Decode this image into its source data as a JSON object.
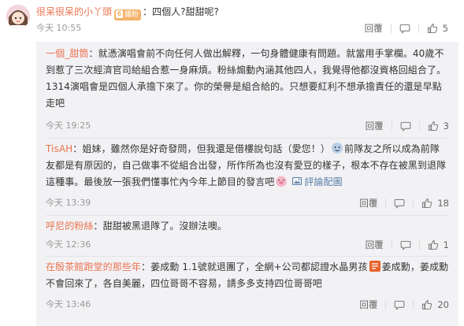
{
  "main_comment": {
    "username": "很呆很呆的小丫頭",
    "badge_level": "6",
    "badge_label": "鐵粉",
    "text": "：四個人?甜甜呢?",
    "time": "今天 10:55",
    "reply_label": "回覆",
    "like_count": "5"
  },
  "replies": [
    {
      "username": "一個_甜筒",
      "text": "：就憑演唱會前不向任何人做出解釋，一句身體健康有問題。就當用手掌欄。40歲不到惹了三次經濟官司給組合惹一身麻煩。粉絲煽動內涵其他四人，我覺得他都沒資格回組合了。1314演唱會是四個人承擔下來了。你的榮譽是組合給的。只想要紅利不想承擔責任的還是早點走吧",
      "time": "今天 19:25",
      "reply_label": "回覆",
      "like_count": "3"
    },
    {
      "username": "TisAH",
      "text_1": "：姐妹，雖然你是好奇發問，但我還是借樓說句話（愛您！）",
      "text_2": "前隊友之所以成為前隊友都是有原因的，自己做事不從組合出發，所作所為也沒有愛豆的樣子，根本不存在被黑到退隊這種事。最後放一張我們懂事忙內今年上節目的發言吧",
      "share_label": "評論配圖",
      "time": "今天 13:39",
      "reply_label": "回覆",
      "like_count": "18"
    },
    {
      "username": "呼尼的粉絲",
      "text": "：甜甜被黑退隊了。沒辦法噢。",
      "time": "今天 12:36",
      "reply_label": "回覆",
      "like_count": "1"
    },
    {
      "username": "在殷茶館跑堂的那些年",
      "text_1": "：姜成勳 1.1號就退團了，全網+公司都認證水晶男孩",
      "text_2": "姜成勳，姜成勳不會回來了，各自美麗，四位哥哥不容易，請多多支持四位哥哥吧",
      "time": "今天 13:46",
      "reply_label": "回覆",
      "like_count": "20"
    }
  ],
  "icons": {
    "comment": "comment-icon",
    "like": "thumbs-up-icon",
    "share": "image-icon"
  },
  "colors": {
    "username": "#eb7350",
    "link": "#5a7ea8",
    "meta": "#999999",
    "reply_bg": "#f2f2f5"
  }
}
